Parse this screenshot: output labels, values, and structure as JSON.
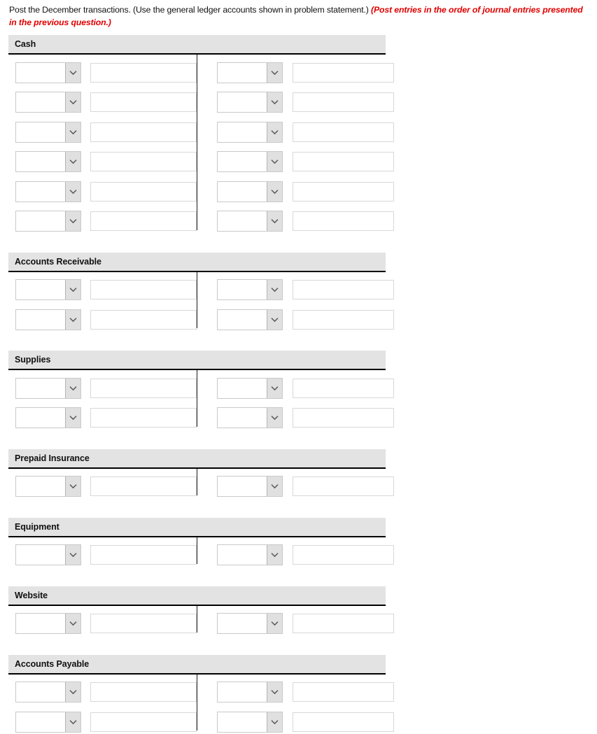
{
  "instruction": {
    "main_text": "Post the December transactions. (Use the general ledger accounts shown in problem statement.) ",
    "emphasis_text": "(Post entries in the order of journal entries presented in the previous question.)",
    "emphasis_color": "#e00000"
  },
  "field_defaults": {
    "select_value": "",
    "select_placeholder": "",
    "amount_value": "",
    "amount_placeholder": "",
    "dropdown_icon": "chevron-down-icon"
  },
  "accounts": [
    {
      "name": "Cash",
      "rows": [
        {
          "debit": {
            "select": "",
            "amount": ""
          },
          "credit": {
            "select": "",
            "amount": ""
          }
        },
        {
          "debit": {
            "select": "",
            "amount": ""
          },
          "credit": {
            "select": "",
            "amount": ""
          }
        },
        {
          "debit": {
            "select": "",
            "amount": ""
          },
          "credit": {
            "select": "",
            "amount": ""
          }
        },
        {
          "debit": {
            "select": "",
            "amount": ""
          },
          "credit": {
            "select": "",
            "amount": ""
          }
        },
        {
          "debit": {
            "select": "",
            "amount": ""
          },
          "credit": {
            "select": "",
            "amount": ""
          }
        },
        {
          "debit": {
            "select": "",
            "amount": ""
          },
          "credit": {
            "select": "",
            "amount": ""
          }
        }
      ]
    },
    {
      "name": "Accounts Receivable",
      "rows": [
        {
          "debit": {
            "select": "",
            "amount": ""
          },
          "credit": {
            "select": "",
            "amount": ""
          }
        },
        {
          "debit": {
            "select": "",
            "amount": ""
          },
          "credit": {
            "select": "",
            "amount": ""
          }
        }
      ]
    },
    {
      "name": "Supplies",
      "rows": [
        {
          "debit": {
            "select": "",
            "amount": ""
          },
          "credit": {
            "select": "",
            "amount": ""
          }
        },
        {
          "debit": {
            "select": "",
            "amount": ""
          },
          "credit": {
            "select": "",
            "amount": ""
          }
        }
      ]
    },
    {
      "name": "Prepaid Insurance",
      "rows": [
        {
          "debit": {
            "select": "",
            "amount": ""
          },
          "credit": {
            "select": "",
            "amount": ""
          }
        }
      ]
    },
    {
      "name": "Equipment",
      "rows": [
        {
          "debit": {
            "select": "",
            "amount": ""
          },
          "credit": {
            "select": "",
            "amount": ""
          }
        }
      ]
    },
    {
      "name": "Website",
      "rows": [
        {
          "debit": {
            "select": "",
            "amount": ""
          },
          "credit": {
            "select": "",
            "amount": ""
          }
        }
      ]
    },
    {
      "name": "Accounts Payable",
      "rows": [
        {
          "debit": {
            "select": "",
            "amount": ""
          },
          "credit": {
            "select": "",
            "amount": ""
          }
        },
        {
          "debit": {
            "select": "",
            "amount": ""
          },
          "credit": {
            "select": "",
            "amount": ""
          }
        }
      ]
    }
  ]
}
